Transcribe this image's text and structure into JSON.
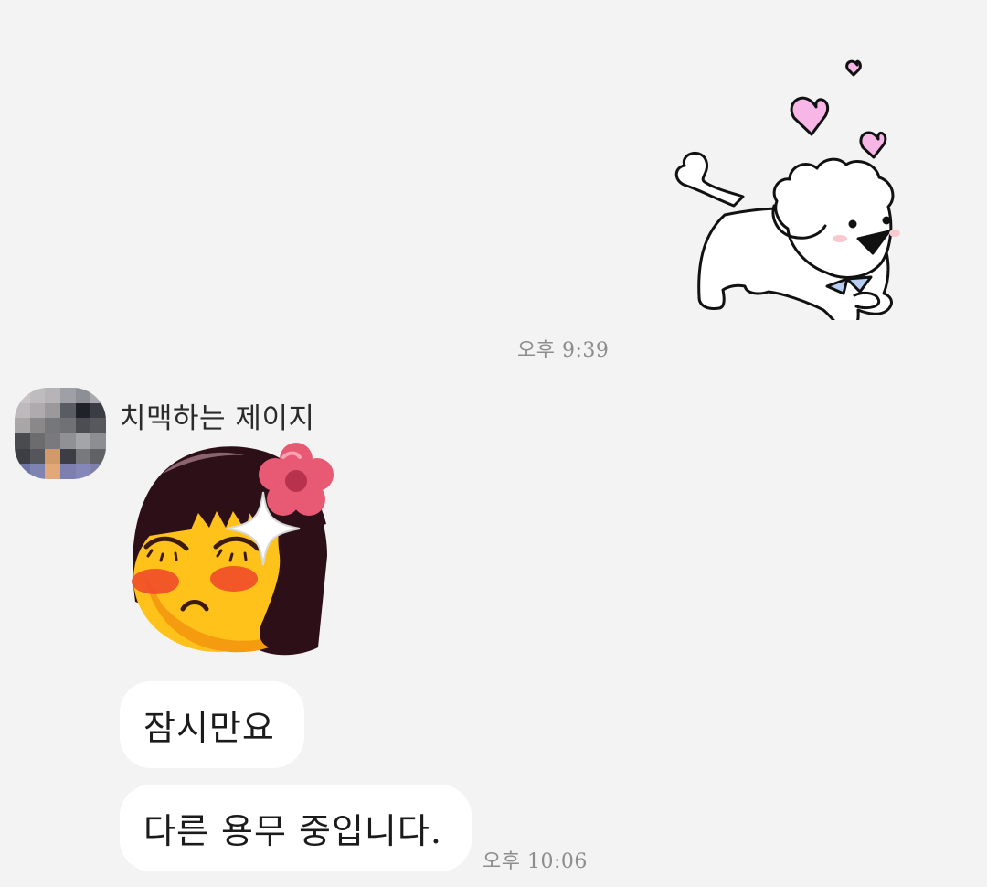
{
  "messages": {
    "outgoing_sticker": {
      "icon": "dog-hearts-sticker",
      "time": "오후 9:39"
    },
    "incoming": {
      "sender_name": "치맥하는 제이지",
      "avatar_icon": "blurred-profile-photo",
      "sticker_icon": "blushing-girl-emoji-sticker",
      "texts": [
        "잠시만요",
        "다른 용무 중입니다."
      ],
      "time": "오후 10:06"
    }
  },
  "colors": {
    "background": "#f3f3f3",
    "bubble": "#ffffff",
    "timestamp": "#8d8d8d",
    "heart": "#f7b6e6"
  }
}
